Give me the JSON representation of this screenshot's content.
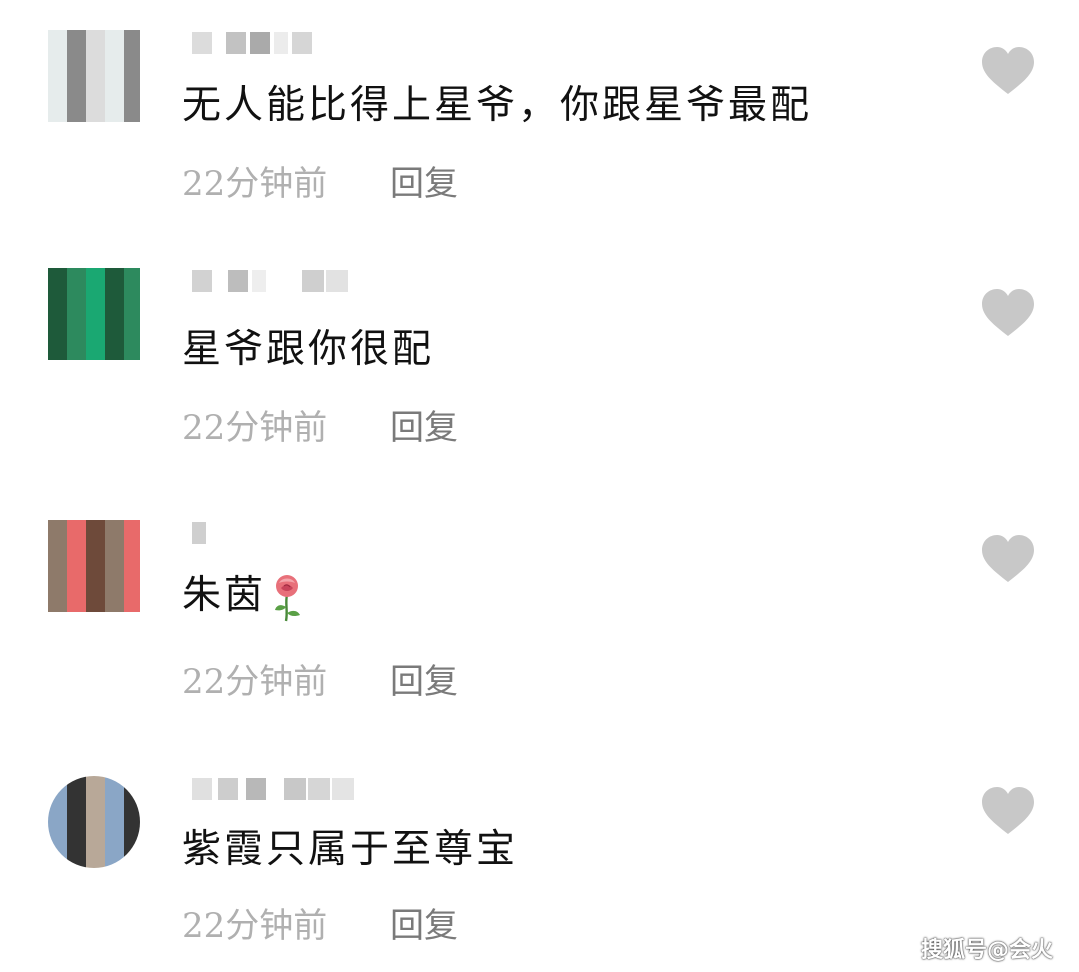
{
  "comments": [
    {
      "text": "无人能比得上星爷，你跟星爷最配",
      "time": "22分钟前",
      "reply": "回复",
      "like_icon": "heart-icon",
      "avatar_colors": [
        "#e6ecec",
        "#bfc8c8",
        "#dfe6e6",
        "#d3dede",
        "#8a8a8a",
        "#b7c7c7",
        "#e9eeee",
        "#a6a6a6",
        "#dcdcdc",
        "#cfd9d9",
        "#7d8a8a",
        "#e2e8e8"
      ]
    },
    {
      "text": "星爷跟你很配",
      "time": "22分钟前",
      "reply": "回复",
      "like_icon": "heart-icon",
      "avatar_colors": [
        "#1e5a3a",
        "#14b36c",
        "#0f8f55",
        "#b0365a",
        "#2d8a5e",
        "#19c07a",
        "#2c3c34",
        "#5fa78a",
        "#1aa872",
        "#4a4a4a",
        "#8c9a92",
        "#c6c6c6"
      ]
    },
    {
      "text": "朱茵",
      "emoji": "rose-icon",
      "time": "22分钟前",
      "reply": "回复",
      "like_icon": "heart-icon",
      "avatar_colors": [
        "#8e7a6a",
        "#c9a39a",
        "#7b5a4a",
        "#d84848",
        "#e86a6a",
        "#a06050",
        "#b48878",
        "#e2b0b0",
        "#6e4a3a",
        "#8a6a5a",
        "#c88888",
        "#d8c0b8"
      ]
    },
    {
      "text": "紫霞只属于至尊宝",
      "time": "22分钟前",
      "reply": "回复",
      "like_icon": "heart-icon",
      "avatar_colors": [
        "#8aa6c6",
        "#b5b5b5",
        "#7c7c7c",
        "#c9b8a8",
        "#333333",
        "#a89888",
        "#e0d8d0",
        "#1c1c1c",
        "#b8a898",
        "#d0c8c0",
        "#5a4a3a",
        "#c8b8a0"
      ]
    }
  ],
  "watermark": "搜狐号@会火",
  "colors": {
    "text": "#111111",
    "time": "#b0b0b0",
    "reply": "#7a7a7a",
    "heart": "#c8c8c8"
  }
}
